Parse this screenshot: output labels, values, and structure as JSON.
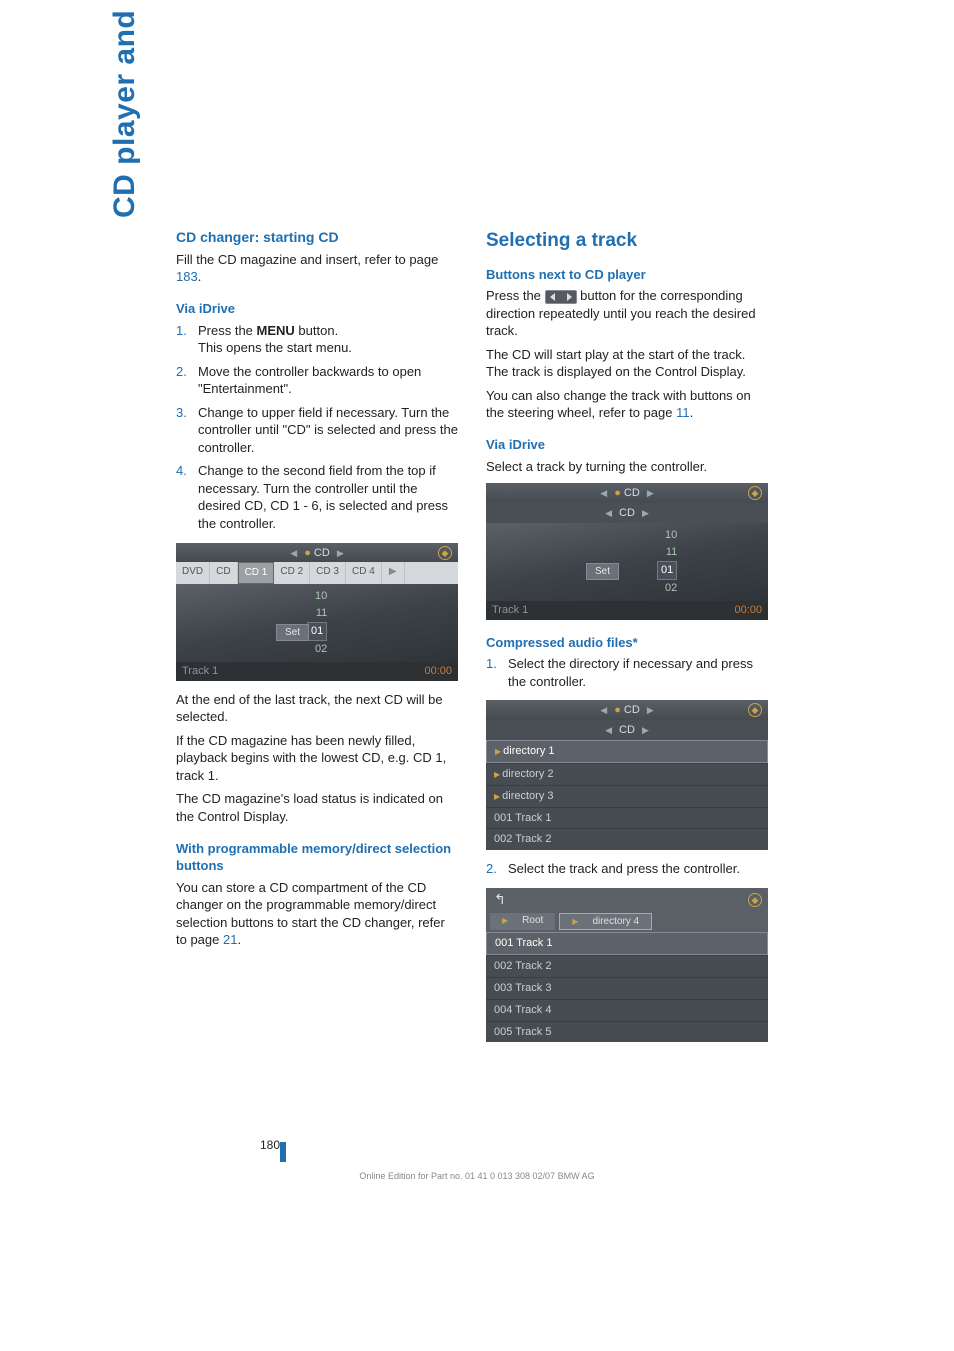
{
  "sidebar": {
    "title": "CD player and CD changer"
  },
  "left": {
    "h1": "CD changer: starting CD",
    "p1a": "Fill the CD magazine and insert, refer to page ",
    "p1_link": "183",
    "p1b": ".",
    "h2": "Via iDrive",
    "steps": [
      {
        "num": "1.",
        "text": "Press the ",
        "bold": "MENU",
        "text2": " button.",
        "cont": "This opens the start menu."
      },
      {
        "num": "2.",
        "text": "Move the controller backwards to open \"Entertainment\"."
      },
      {
        "num": "3.",
        "text": "Change to upper field if necessary. Turn the controller until \"CD\" is selected and press the controller."
      },
      {
        "num": "4.",
        "text": "Change to the second field from the top if necessary. Turn the controller until the desired CD, CD 1 - 6, is selected and press the controller."
      }
    ],
    "shot1": {
      "top_label": "CD",
      "tabs": [
        "DVD",
        "CD",
        "CD 1",
        "CD 2",
        "CD 3",
        "CD 4"
      ],
      "selected_tab": 2,
      "center": [
        "10",
        "11",
        "01",
        "02"
      ],
      "hi_index": 2,
      "set": "Set",
      "footer_left": "Track 1",
      "footer_right": "00:00"
    },
    "p3": "At the end of the last track, the next CD will be selected.",
    "p4": "If the CD magazine has been newly filled, playback begins with the lowest CD, e.g. CD 1, track 1.",
    "p5": "The CD magazine's load status is indicated on the Control Display.",
    "h3": "With programmable memory/direct selection buttons",
    "p6a": "You can store a CD compartment of the CD changer on the programmable memory/direct selection buttons to start the CD changer, refer to page ",
    "p6_link": "21",
    "p6b": "."
  },
  "right": {
    "h1": "Selecting a track",
    "h2": "Buttons next to CD player",
    "p1a": "Press the ",
    "p1b": " button for the corresponding direction repeatedly until you reach the desired track.",
    "p2": "The CD will start play at the start of the track. The track is displayed on the Control Display.",
    "p3a": "You can also change the track with buttons on the steering wheel, refer to page ",
    "p3_link": "11",
    "p3b": ".",
    "h3": "Via iDrive",
    "p4": "Select a track by turning the controller.",
    "shot2": {
      "top_label": "CD",
      "sub_label": "CD",
      "center": [
        "10",
        "11",
        "01",
        "02"
      ],
      "hi_index": 2,
      "set": "Set",
      "footer_left": "Track 1",
      "footer_right": "00:00"
    },
    "h4": "Compressed audio files*",
    "step1": {
      "num": "1.",
      "text": "Select the directory if necessary and press the controller."
    },
    "shot3": {
      "top_label": "CD",
      "sub_label": "CD",
      "rows": [
        "directory 1",
        "directory 2",
        "directory 3",
        "001 Track 1",
        "002 Track 2"
      ],
      "selected_row": 0
    },
    "step2": {
      "num": "2.",
      "text": "Select the track and press the controller."
    },
    "shot4": {
      "breadcrumb": [
        "Root",
        "directory 4"
      ],
      "breadcrumb_sel": 1,
      "rows": [
        "001 Track 1",
        "002 Track 2",
        "003 Track 3",
        "004 Track 4",
        "005 Track 5"
      ],
      "selected_row": 0
    }
  },
  "footer": {
    "page": "180",
    "line": "Online Edition for Part no. 01 41 0 013 308 02/07 BMW AG"
  }
}
